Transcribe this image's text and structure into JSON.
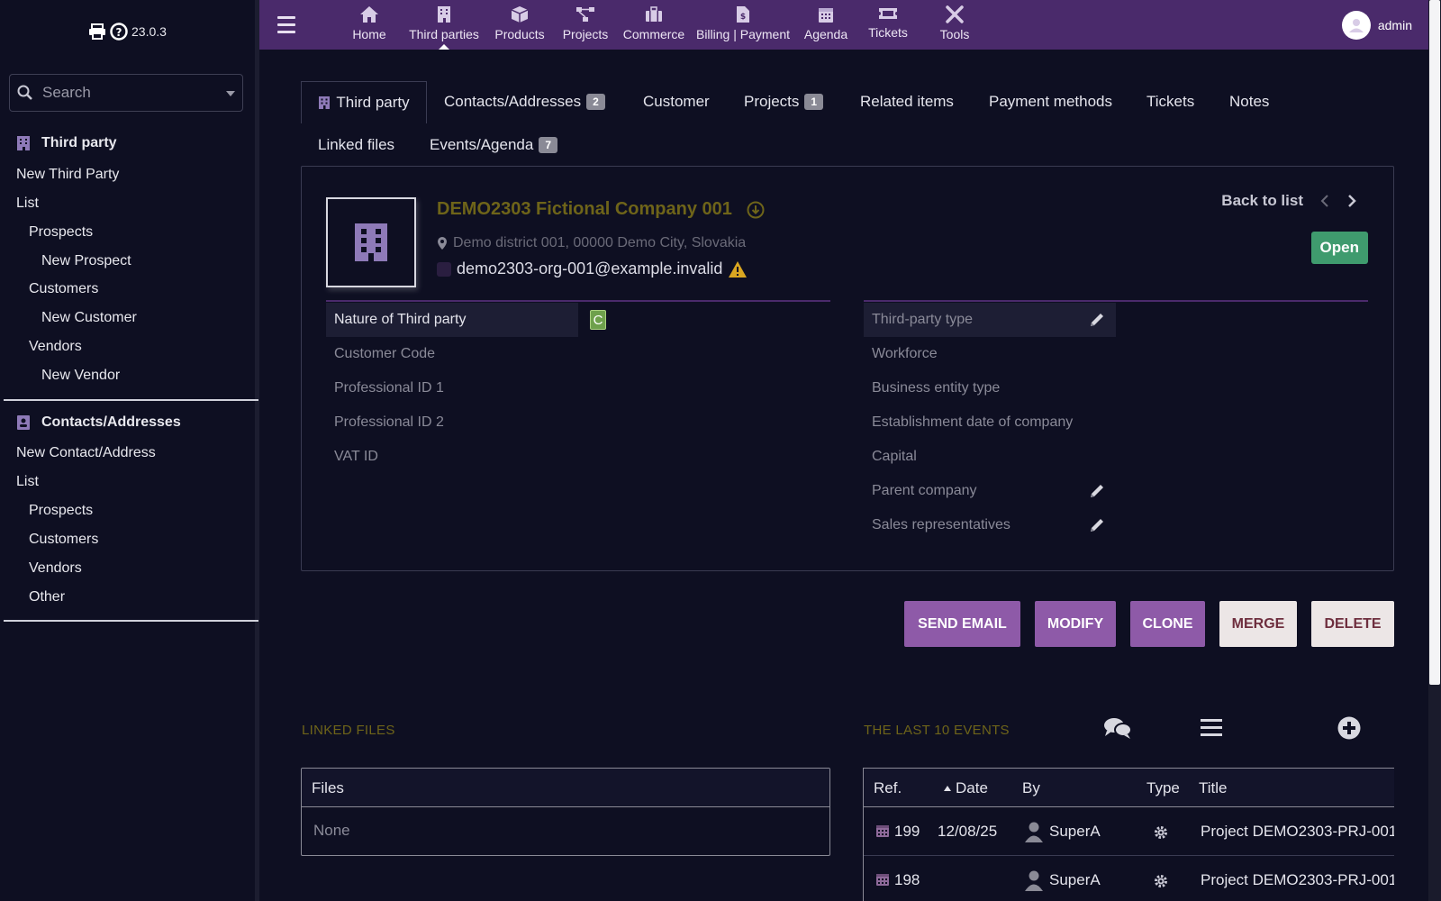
{
  "app": {
    "version": "23.0.3",
    "user": "admin"
  },
  "sidebar": {
    "search_placeholder": "Search",
    "section1": {
      "title": "Third party",
      "items": [
        "New Third Party",
        "List",
        "Prospects",
        "New Prospect",
        "Customers",
        "New Customer",
        "Vendors",
        "New Vendor"
      ]
    },
    "section2": {
      "title": "Contacts/Addresses",
      "items": [
        "New Contact/Address",
        "List",
        "Prospects",
        "Customers",
        "Vendors",
        "Other"
      ]
    }
  },
  "topnav": {
    "items": [
      {
        "label": "Home",
        "icon": "home-icon"
      },
      {
        "label": "Third parties",
        "icon": "building-icon"
      },
      {
        "label": "Products",
        "icon": "cube-icon"
      },
      {
        "label": "Projects",
        "icon": "project-icon"
      },
      {
        "label": "Commerce",
        "icon": "briefcase-icon"
      },
      {
        "label": "Billing | Payment",
        "icon": "invoice-icon"
      },
      {
        "label": "Agenda",
        "icon": "calendar-icon"
      },
      {
        "label": "Tickets",
        "icon": "ticket-icon"
      },
      {
        "label": "Tools",
        "icon": "tools-icon"
      }
    ]
  },
  "tabs": {
    "third_party": "Third party",
    "contacts": "Contacts/Addresses",
    "contacts_count": "2",
    "customer": "Customer",
    "projects": "Projects",
    "projects_count": "1",
    "related": "Related items",
    "payment": "Payment methods",
    "tickets": "Tickets",
    "notes": "Notes",
    "linked_files": "Linked files",
    "events": "Events/Agenda",
    "events_count": "7"
  },
  "company": {
    "name": "DEMO2303 Fictional Company 001",
    "address": "Demo district 001, 00000 Demo City, Slovakia",
    "email": "demo2303-org-001@example.invalid",
    "back_to_list": "Back to list",
    "status": "Open"
  },
  "fields_left": {
    "nature": "Nature of Third party",
    "nature_value": "C",
    "customer_code": "Customer Code",
    "prof_id1": "Professional ID 1",
    "prof_id2": "Professional ID 2",
    "vat_id": "VAT ID"
  },
  "fields_right": {
    "type": "Third-party type",
    "workforce": "Workforce",
    "business_entity": "Business entity type",
    "establishment": "Establishment date of company",
    "capital": "Capital",
    "parent": "Parent company",
    "sales_reps": "Sales representatives"
  },
  "actions": {
    "send_email": "SEND EMAIL",
    "modify": "MODIFY",
    "clone": "CLONE",
    "merge": "MERGE",
    "delete": "DELETE"
  },
  "linked_files": {
    "title": "LINKED FILES",
    "header": "Files",
    "empty": "None"
  },
  "events": {
    "title": "THE LAST 10 EVENTS",
    "columns": {
      "ref": "Ref.",
      "date": "Date",
      "by": "By",
      "type": "Type",
      "title": "Title"
    },
    "rows": [
      {
        "ref": "199",
        "date": "12/08/25",
        "by": "SuperA",
        "title": "Project DEMO2303-PRJ-001"
      },
      {
        "ref": "198",
        "date": "",
        "by": "SuperA",
        "title": "Project DEMO2303-PRJ-001"
      }
    ]
  }
}
